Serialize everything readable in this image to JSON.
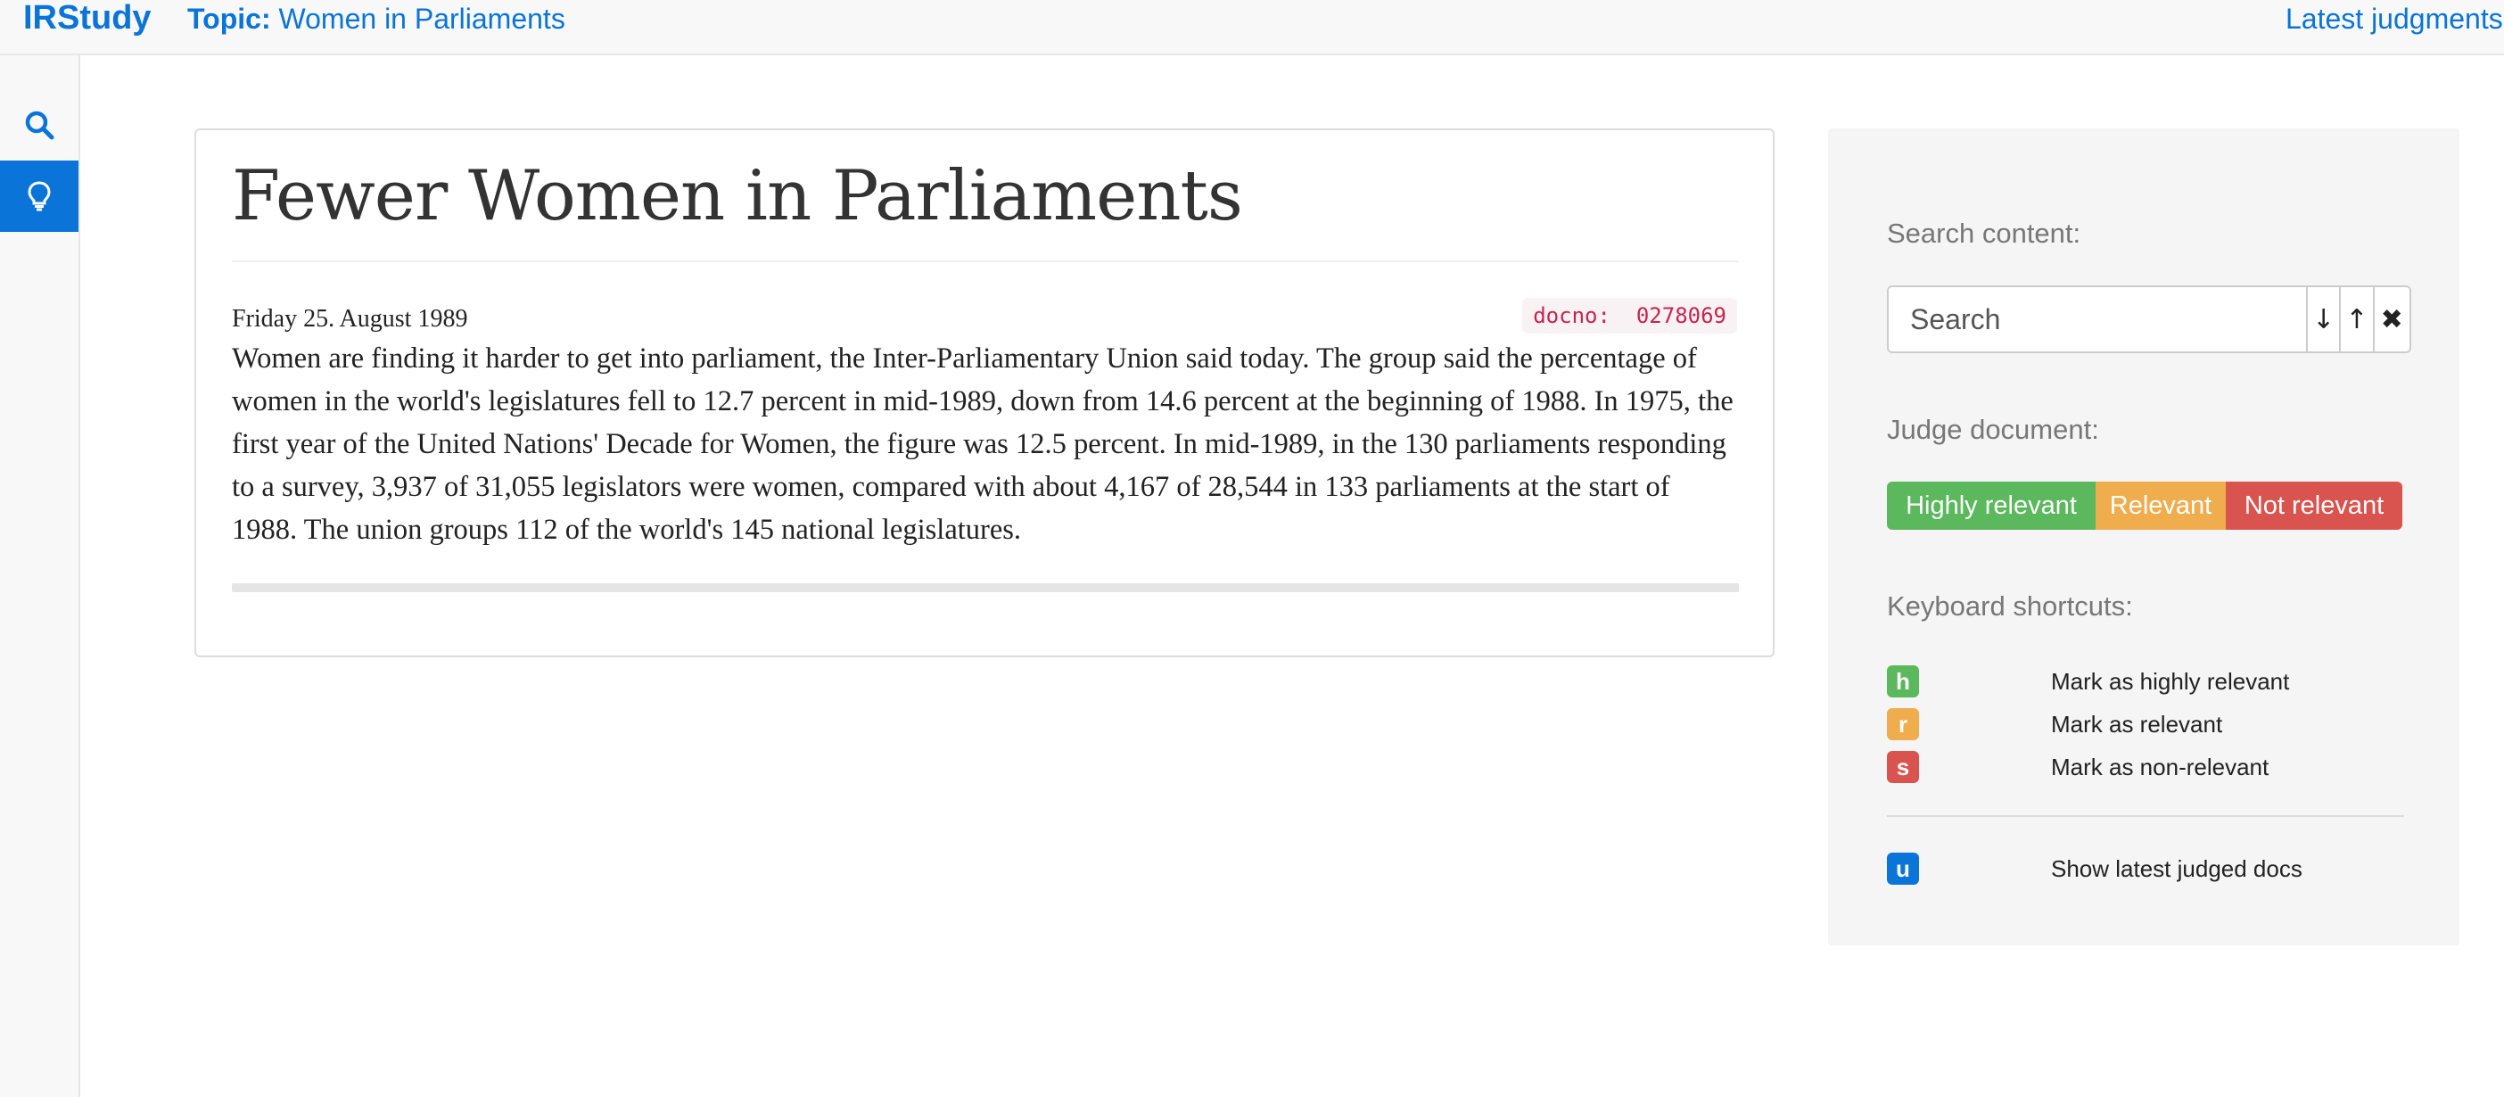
{
  "navbar": {
    "brand": "IRStudy",
    "topic_label": "Topic:",
    "topic_value": "Women in Parliaments",
    "latest_link": "Latest judgments"
  },
  "sidebar": {
    "items": [
      {
        "icon": "search-icon",
        "active": false
      },
      {
        "icon": "lightbulb-icon",
        "active": true
      }
    ]
  },
  "document": {
    "title": "Fewer Women in Parliaments",
    "date": "Friday 25. August 1989",
    "docno_label": "docno:",
    "docno_value": "0278069",
    "body": "Women are finding it harder to get into parliament, the Inter-Parliamentary Union said today. The group said the percentage of women in the world's legislatures fell to 12.7 percent in mid-1989, down from 14.6 percent at the beginning of 1988. In 1975, the first year of the United Nations' Decade for Women, the figure was 12.5 percent. In mid-1989, in the 130 parliaments responding to a survey, 3,937 of 31,055 legislators were women, compared with about 4,167 of 28,544 in 133 parliaments at the start of 1988. The union groups 112 of the world's 145 national legislatures."
  },
  "search": {
    "label": "Search content:",
    "placeholder": "Search",
    "down_label": "↓",
    "up_label": "↑",
    "clear_label": "✖"
  },
  "judge": {
    "label": "Judge document:",
    "highly_relevant": "Highly relevant",
    "relevant": "Relevant",
    "not_relevant": "Not relevant"
  },
  "shortcuts": {
    "label": "Keyboard shortcuts:",
    "items": [
      {
        "key": "h",
        "desc": "Mark as highly relevant",
        "color": "#5cb85c"
      },
      {
        "key": "r",
        "desc": "Mark as relevant",
        "color": "#f0ad4e"
      },
      {
        "key": "s",
        "desc": "Mark as non-relevant",
        "color": "#d9534f"
      },
      {
        "key": "u",
        "desc": "Show latest judged docs",
        "color": "#0a74d9"
      }
    ]
  },
  "colors": {
    "accent": "#0a74d9",
    "success": "#5cb85c",
    "warning": "#f0ad4e",
    "danger": "#d9534f"
  }
}
